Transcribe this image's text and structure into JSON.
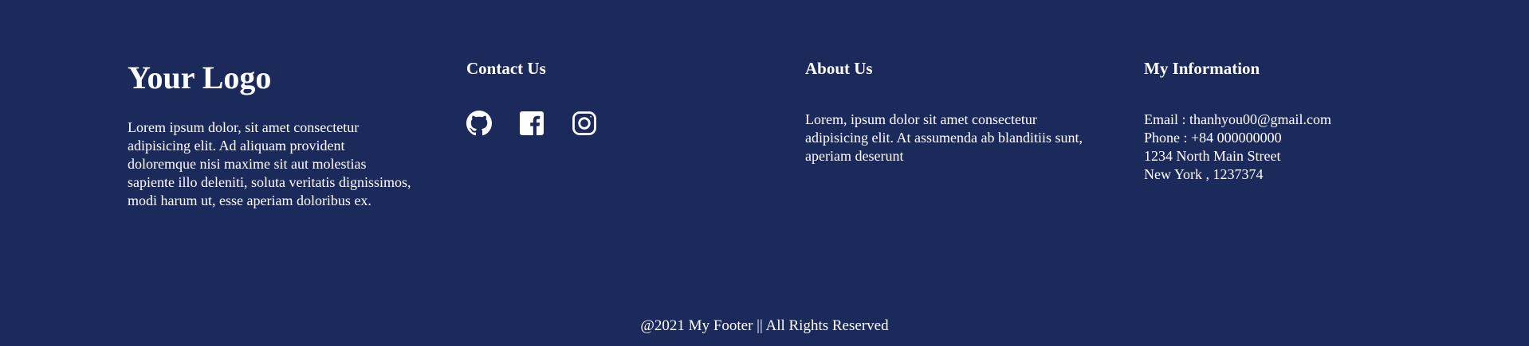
{
  "colors": {
    "background": "#1b2a5a",
    "text": "#ffffff"
  },
  "brand": {
    "logo_text": "Your Logo",
    "description": "Lorem ipsum dolor, sit amet consectetur adipisicing elit. Ad aliquam provident doloremque nisi maxime sit aut molestias sapiente illo deleniti, soluta veritatis dignissimos, modi harum ut, esse aperiam doloribus ex."
  },
  "contact": {
    "heading": "Contact Us",
    "social_icons": [
      "github-icon",
      "facebook-icon",
      "instagram-icon"
    ]
  },
  "about": {
    "heading": "About Us",
    "text": "Lorem, ipsum dolor sit amet consectetur adipisicing elit. At assumenda ab blanditiis sunt, aperiam deserunt"
  },
  "info": {
    "heading": "My Information",
    "email": "Email : thanhyou00@gmail.com",
    "phone": "Phone : +84 000000000",
    "street": "1234 North Main Street",
    "city": "New York , 1237374"
  },
  "footer": {
    "copyright": "@2021 My Footer || All Rights Reserved"
  }
}
